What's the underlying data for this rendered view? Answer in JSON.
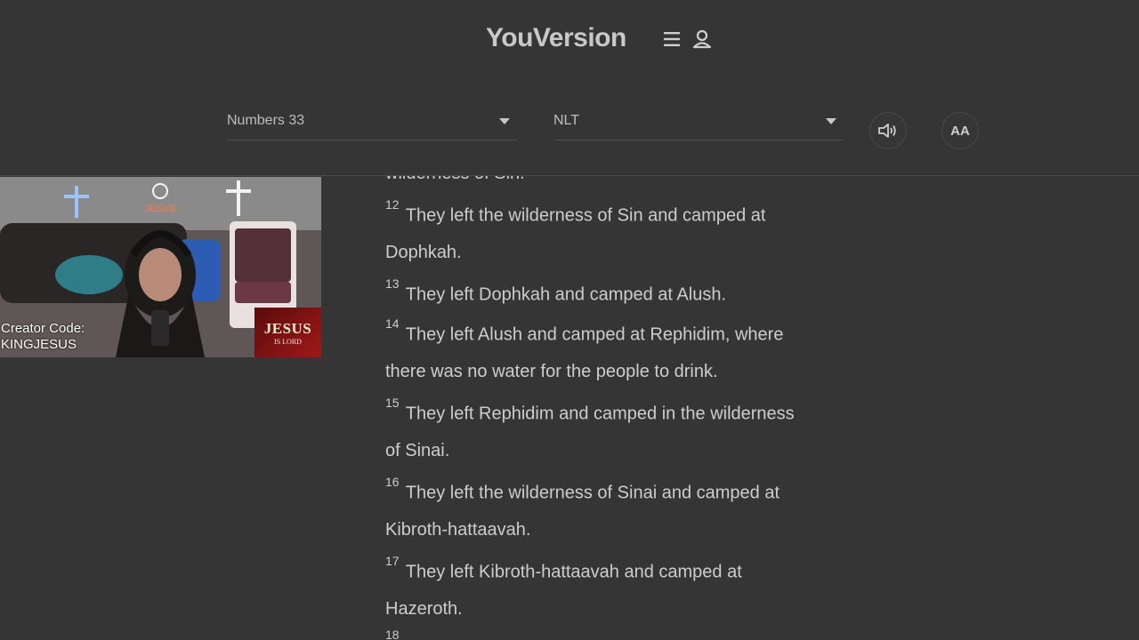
{
  "header": {
    "brand": "YouVersion",
    "menu_icon": "hamburger-menu-icon",
    "user_icon": "user-profile-icon"
  },
  "controls": {
    "book_chapter": "Numbers 33",
    "version": "NLT",
    "audio_icon": "speaker-audio-icon",
    "font_size_label": "AA"
  },
  "reader": {
    "partial_top": "wilderness of Sin.",
    "verses": [
      {
        "num": "12",
        "line1": "They left the wilderness of Sin and camped at",
        "line2": "Dophkah."
      },
      {
        "num": "13",
        "line1": "They left Dophkah and camped at Alush.",
        "line2": ""
      },
      {
        "num": "14",
        "line1": "They left Alush and camped at Rephidim, where",
        "line2": "there was no water for the people to drink."
      },
      {
        "num": "15",
        "line1": "They left Rephidim and camped in the wilderness",
        "line2": "of Sinai."
      },
      {
        "num": "16",
        "line1": "They left the wilderness of Sinai and camped at",
        "line2": "Kibroth-hattaavah."
      },
      {
        "num": "17",
        "line1": "They left Kibroth-hattaavah and camped at",
        "line2": "Hazeroth."
      }
    ],
    "partial_bottom_num": "18"
  },
  "webcam": {
    "creator_label": "Creator Code:",
    "creator_code": "KINGJESUS",
    "badge_main": "JESUS",
    "badge_sub": "IS LORD",
    "neon_sign": "JESUS"
  },
  "colors": {
    "background": "#353535",
    "text": "#cdcdcd",
    "badge_red": "#a01818"
  }
}
